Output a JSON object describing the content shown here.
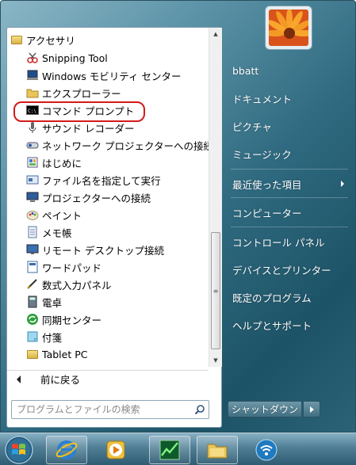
{
  "program_list": {
    "items": [
      {
        "label": "アクセサリ",
        "icon": "folder-icon",
        "indent": 0
      },
      {
        "label": "Snipping Tool",
        "icon": "scissors-icon",
        "indent": 1
      },
      {
        "label": "Windows モビリティ センター",
        "icon": "mobility-center-icon",
        "indent": 1
      },
      {
        "label": "エクスプローラー",
        "icon": "explorer-icon",
        "indent": 1
      },
      {
        "label": "コマンド プロンプト",
        "icon": "command-prompt-icon",
        "indent": 1
      },
      {
        "label": "サウンド レコーダー",
        "icon": "microphone-icon",
        "indent": 1
      },
      {
        "label": "ネットワーク プロジェクターへの接続",
        "icon": "network-projector-icon",
        "indent": 1
      },
      {
        "label": "はじめに",
        "icon": "getting-started-icon",
        "indent": 1
      },
      {
        "label": "ファイル名を指定して実行",
        "icon": "run-icon",
        "indent": 1
      },
      {
        "label": "プロジェクターへの接続",
        "icon": "projector-icon",
        "indent": 1
      },
      {
        "label": "ペイント",
        "icon": "paint-icon",
        "indent": 1
      },
      {
        "label": "メモ帳",
        "icon": "notepad-icon",
        "indent": 1
      },
      {
        "label": "リモート デスクトップ接続",
        "icon": "remote-desktop-icon",
        "indent": 1
      },
      {
        "label": "ワードパッド",
        "icon": "wordpad-icon",
        "indent": 1
      },
      {
        "label": "数式入力パネル",
        "icon": "math-input-icon",
        "indent": 1
      },
      {
        "label": "電卓",
        "icon": "calculator-icon",
        "indent": 1
      },
      {
        "label": "同期センター",
        "icon": "sync-center-icon",
        "indent": 1
      },
      {
        "label": "付箋",
        "icon": "sticky-notes-icon",
        "indent": 1
      },
      {
        "label": "Tablet PC",
        "icon": "folder-icon",
        "indent": 1
      }
    ],
    "highlighted": "コマンド プロンプト"
  },
  "back": {
    "label": "前に戻る"
  },
  "search": {
    "placeholder": "プログラムとファイルの検索"
  },
  "right_links": [
    {
      "label": "bbatt",
      "has_arrow": false
    },
    {
      "label": "ドキュメント",
      "has_arrow": false
    },
    {
      "label": "ピクチャ",
      "has_arrow": false
    },
    {
      "label": "ミュージック",
      "has_arrow": false
    },
    {
      "label": "最近使った項目",
      "has_arrow": true
    },
    {
      "label": "コンピューター",
      "has_arrow": false
    },
    {
      "label": "コントロール パネル",
      "has_arrow": false
    },
    {
      "label": "デバイスとプリンター",
      "has_arrow": false
    },
    {
      "label": "既定のプログラム",
      "has_arrow": false
    },
    {
      "label": "ヘルプとサポート",
      "has_arrow": false
    }
  ],
  "shutdown": {
    "label": "シャットダウン"
  },
  "taskbar": {
    "buttons": [
      "start-orb",
      "internet-explorer-icon",
      "media-player-icon",
      "activity-monitor-icon",
      "file-explorer-icon",
      "wifi-icon"
    ]
  },
  "colors": {
    "highlight_ring": "#d41a1a",
    "menu_gradient_dark": "#1d5366",
    "menu_gradient_light": "#8ab6c6"
  }
}
